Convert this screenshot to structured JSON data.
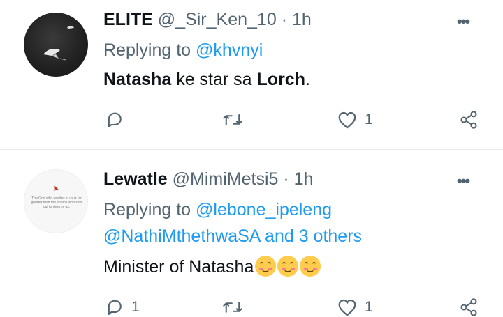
{
  "tweets": [
    {
      "name": "ELITE",
      "handle": "@_Sir_Ken_10",
      "separator": "·",
      "time": "1h",
      "replying_prefix": "Replying to",
      "replying_to": "@khvnyi",
      "body": {
        "bold1": "Natasha",
        "mid": " ke star sa ",
        "bold2": "Lorch",
        "end": "."
      },
      "more_label": "•••",
      "actions": {
        "reply_count": "",
        "retweet_count": "",
        "like_count": "1"
      }
    },
    {
      "name": "Lewatle",
      "handle": "@MimiMetsi5",
      "separator": "·",
      "time": "1h",
      "avatar_text": "The God who resides in us is far greater than the enemy who sets out to destroy us.",
      "replying_prefix": "Replying to",
      "replying_to": "@lebone_ipeleng",
      "replying_to_2": "@NathiMthethwaSA and 3 others",
      "body": {
        "text": "Minister of Natasha",
        "emoji_names": [
          "smiling-face-with-smiling-eyes",
          "smiling-face-with-smiling-eyes",
          "smiling-face-with-smiling-eyes"
        ]
      },
      "more_label": "•••",
      "actions": {
        "reply_count": "1",
        "retweet_count": "",
        "like_count": "1"
      }
    }
  ],
  "colors": {
    "link": "#1d9bf0",
    "muted": "#536471",
    "text": "#0f1419",
    "divider": "#e6ecf0"
  },
  "icons": [
    "reply-icon",
    "retweet-icon",
    "like-icon",
    "share-icon",
    "more-icon"
  ]
}
